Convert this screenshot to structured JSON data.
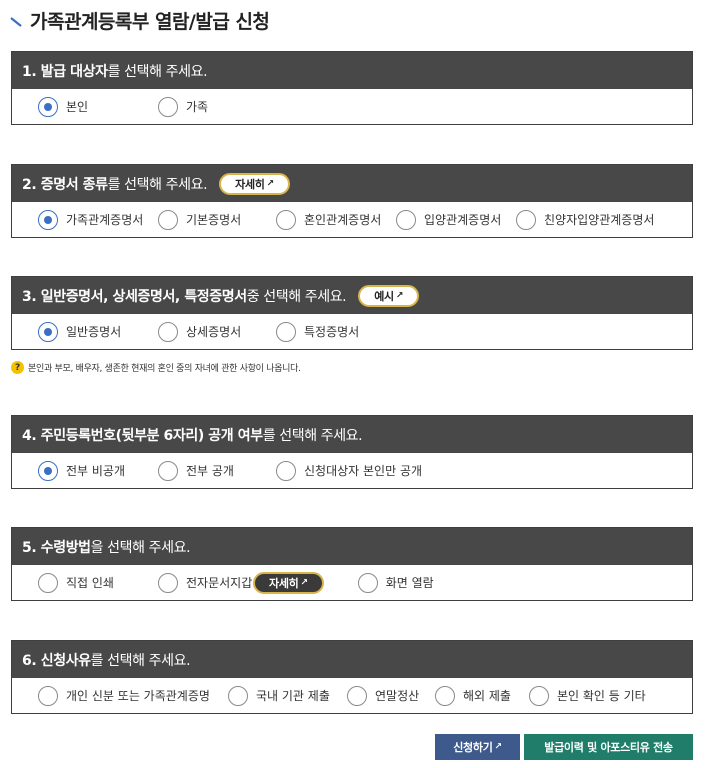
{
  "page": {
    "title": "가족관계등록부 열람/발급 신청"
  },
  "sections": [
    {
      "heading_bold": "1. 발급 대상자",
      "heading_rest": "를 선택해 주세요.",
      "options": [
        {
          "label": "본인",
          "checked": true
        },
        {
          "label": "가족",
          "checked": false
        }
      ]
    },
    {
      "heading_bold": "2. 증명서 종류",
      "heading_rest": "를 선택해 주세요.",
      "pill": "자세히",
      "options": [
        {
          "label": "가족관계증명서",
          "checked": true
        },
        {
          "label": "기본증명서",
          "checked": false
        },
        {
          "label": "혼인관계증명서",
          "checked": false
        },
        {
          "label": "입양관계증명서",
          "checked": false
        },
        {
          "label": "친양자입양관계증명서",
          "checked": false
        }
      ]
    },
    {
      "heading_bold": "3. 일반증명서, 상세증명서, 특정증명서",
      "heading_rest": " 중 선택해 주세요.",
      "pill": "예시",
      "options": [
        {
          "label": "일반증명서",
          "checked": true
        },
        {
          "label": "상세증명서",
          "checked": false
        },
        {
          "label": "특정증명서",
          "checked": false
        }
      ],
      "note": "본인과 부모, 배우자, 생존한 현재의 혼인 중의 자녀에 관한 사항이 나옵니다."
    },
    {
      "heading_bold": "4. 주민등록번호(뒷부분 6자리) 공개 여부",
      "heading_rest": "를 선택해 주세요.",
      "options": [
        {
          "label": "전부 비공개",
          "checked": true
        },
        {
          "label": "전부 공개",
          "checked": false
        },
        {
          "label": "신청대상자 본인만 공개",
          "checked": false
        }
      ]
    },
    {
      "heading_bold": "5. 수령방법",
      "heading_rest": "을 선택해 주세요.",
      "options": [
        {
          "label": "직접 인쇄",
          "checked": false
        },
        {
          "label": "전자문서지갑",
          "checked": false
        },
        {
          "label": "화면 열람",
          "checked": false
        }
      ],
      "inline_pill": "자세히"
    },
    {
      "heading_bold": "6. 신청사유",
      "heading_rest": "를 선택해 주세요.",
      "options": [
        {
          "label": "개인 신분 또는 가족관계증명",
          "checked": false
        },
        {
          "label": "국내 기관 제출",
          "checked": false
        },
        {
          "label": "연말정산",
          "checked": false
        },
        {
          "label": "해외 제출",
          "checked": false
        },
        {
          "label": "본인 확인 등 기타",
          "checked": false
        }
      ]
    }
  ],
  "buttons": {
    "apply": "신청하기",
    "send": "발급이력 및 아포스티유 전송"
  },
  "icons": {
    "external_link": "↗",
    "help": "?"
  },
  "colors": {
    "header_bg": "#484848",
    "radio_checked": "#3a6fc5",
    "pill_border": "#d8b54a",
    "apply_btn": "#3e5a8c",
    "send_btn": "#1f7d6a"
  }
}
